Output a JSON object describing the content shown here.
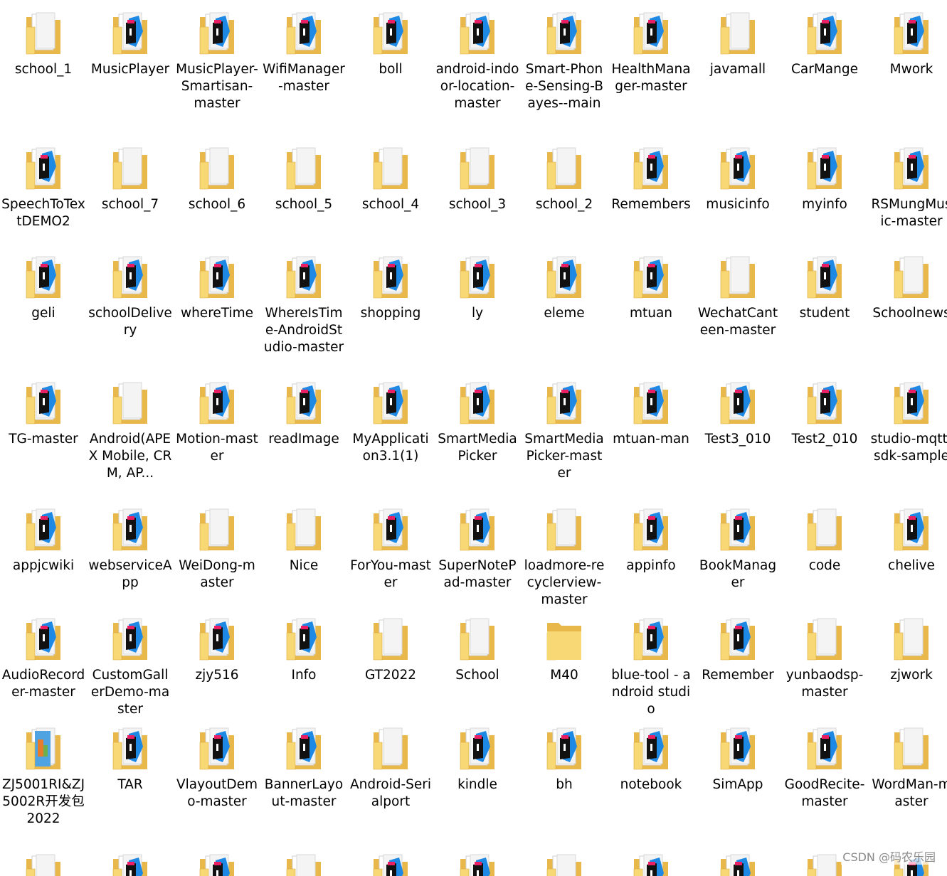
{
  "colors": {
    "folder_back": "#E8B84A",
    "folder_front": "#F8D775",
    "folder_edge": "#D9A838",
    "paper": "#FFFFFF",
    "android_blue": "#1E88E5",
    "ide_black": "#111111",
    "ide_pink": "#E91E63",
    "label_text": "#000000"
  },
  "folders": [
    {
      "label": "school_1",
      "icon": "folder-with-documents-icon"
    },
    {
      "label": "MusicPlayer",
      "icon": "folder-android-studio-icon"
    },
    {
      "label": "MusicPlayer-Smartisan-master",
      "icon": "folder-android-studio-icon"
    },
    {
      "label": "WifiManager-master",
      "icon": "folder-android-studio-icon"
    },
    {
      "label": "boll",
      "icon": "folder-android-studio-icon"
    },
    {
      "label": "android-indoor-location-master",
      "icon": "folder-android-studio-icon"
    },
    {
      "label": "Smart-Phone-Sensing-Bayes--main",
      "icon": "folder-android-studio-icon"
    },
    {
      "label": "HealthManager-master",
      "icon": "folder-android-studio-icon"
    },
    {
      "label": "javamall",
      "icon": "folder-with-documents-icon"
    },
    {
      "label": "CarMange",
      "icon": "folder-android-studio-icon"
    },
    {
      "label": "Mwork",
      "icon": "folder-android-studio-icon"
    },
    {
      "label": "SpeechToTextDEMO2",
      "icon": "folder-android-studio-icon"
    },
    {
      "label": "school_7",
      "icon": "folder-with-documents-icon"
    },
    {
      "label": "school_6",
      "icon": "folder-with-documents-icon"
    },
    {
      "label": "school_5",
      "icon": "folder-with-documents-icon"
    },
    {
      "label": "school_4",
      "icon": "folder-with-documents-icon"
    },
    {
      "label": "school_3",
      "icon": "folder-with-documents-icon"
    },
    {
      "label": "school_2",
      "icon": "folder-with-documents-icon"
    },
    {
      "label": "Remembers",
      "icon": "folder-android-studio-icon"
    },
    {
      "label": "musicinfo",
      "icon": "folder-android-studio-icon"
    },
    {
      "label": "myinfo",
      "icon": "folder-android-studio-icon"
    },
    {
      "label": "RSMungMusic-master",
      "icon": "folder-android-studio-icon"
    },
    {
      "label": "geli",
      "icon": "folder-android-studio-icon"
    },
    {
      "label": "schoolDelivery",
      "icon": "folder-android-studio-icon"
    },
    {
      "label": "whereTime",
      "icon": "folder-android-studio-icon"
    },
    {
      "label": "WhereIsTime-AndroidStudio-master",
      "icon": "folder-android-studio-icon"
    },
    {
      "label": "shopping",
      "icon": "folder-android-studio-icon"
    },
    {
      "label": "ly",
      "icon": "folder-android-studio-icon"
    },
    {
      "label": "eleme",
      "icon": "folder-android-studio-icon"
    },
    {
      "label": "mtuan",
      "icon": "folder-android-studio-icon"
    },
    {
      "label": "WechatCanteen-master",
      "icon": "folder-with-documents-icon"
    },
    {
      "label": "student",
      "icon": "folder-android-studio-icon"
    },
    {
      "label": "Schoolnews",
      "icon": "folder-with-documents-icon"
    },
    {
      "label": "TG-master",
      "icon": "folder-android-studio-icon"
    },
    {
      "label": "Android(APEX Mobile, CRM, AP...",
      "icon": "folder-with-documents-icon"
    },
    {
      "label": "Motion-master",
      "icon": "folder-android-studio-icon"
    },
    {
      "label": "readImage",
      "icon": "folder-android-studio-icon"
    },
    {
      "label": "MyApplication3.1(1)",
      "icon": "folder-android-studio-icon"
    },
    {
      "label": "SmartMediaPicker",
      "icon": "folder-android-studio-icon"
    },
    {
      "label": "SmartMediaPicker-master",
      "icon": "folder-android-studio-icon"
    },
    {
      "label": "mtuan-man",
      "icon": "folder-android-studio-icon"
    },
    {
      "label": "Test3_010",
      "icon": "folder-android-studio-icon"
    },
    {
      "label": "Test2_010",
      "icon": "folder-android-studio-icon"
    },
    {
      "label": "studio-mqtt-sdk-sample",
      "icon": "folder-android-studio-icon"
    },
    {
      "label": "appjcwiki",
      "icon": "folder-android-studio-icon"
    },
    {
      "label": "webserviceApp",
      "icon": "folder-android-studio-icon"
    },
    {
      "label": "WeiDong-master",
      "icon": "folder-with-documents-icon"
    },
    {
      "label": "Nice",
      "icon": "folder-with-documents-icon"
    },
    {
      "label": "ForYou-master",
      "icon": "folder-android-studio-icon"
    },
    {
      "label": "SuperNotePad-master",
      "icon": "folder-android-studio-icon"
    },
    {
      "label": "loadmore-recyclerview-master",
      "icon": "folder-with-documents-icon"
    },
    {
      "label": "appinfo",
      "icon": "folder-android-studio-icon"
    },
    {
      "label": "BookManager",
      "icon": "folder-android-studio-icon"
    },
    {
      "label": "code",
      "icon": "folder-with-documents-icon"
    },
    {
      "label": "chelive",
      "icon": "folder-android-studio-icon"
    },
    {
      "label": "AudioRecorder-master",
      "icon": "folder-android-studio-icon"
    },
    {
      "label": "CustomGallerDemo-master",
      "icon": "folder-android-studio-icon"
    },
    {
      "label": "zjy516",
      "icon": "folder-android-studio-icon"
    },
    {
      "label": "Info",
      "icon": "folder-android-studio-icon"
    },
    {
      "label": "GT2022",
      "icon": "folder-with-documents-icon"
    },
    {
      "label": "School",
      "icon": "folder-with-documents-icon"
    },
    {
      "label": "M40",
      "icon": "folder-icon"
    },
    {
      "label": "blue-tool - android studio",
      "icon": "folder-android-studio-icon"
    },
    {
      "label": "Remember",
      "icon": "folder-android-studio-icon"
    },
    {
      "label": "yunbaodsp-master",
      "icon": "folder-with-documents-icon"
    },
    {
      "label": "zjwork",
      "icon": "folder-with-documents-icon"
    },
    {
      "label": "ZJ5001RI&ZJ5002R开发包2022",
      "icon": "folder-archive-icon"
    },
    {
      "label": "TAR",
      "icon": "folder-android-studio-icon"
    },
    {
      "label": "VlayoutDemo-master",
      "icon": "folder-android-studio-icon"
    },
    {
      "label": "BannerLayout-master",
      "icon": "folder-android-studio-icon"
    },
    {
      "label": "Android-Serialport",
      "icon": "folder-with-documents-icon"
    },
    {
      "label": "kindle",
      "icon": "folder-android-studio-icon"
    },
    {
      "label": "bh",
      "icon": "folder-android-studio-icon"
    },
    {
      "label": "notebook",
      "icon": "folder-android-studio-icon"
    },
    {
      "label": "SimApp",
      "icon": "folder-android-studio-icon"
    },
    {
      "label": "GoodRecite-master",
      "icon": "folder-android-studio-icon"
    },
    {
      "label": "WordMan-master",
      "icon": "folder-with-documents-icon"
    }
  ],
  "partial_row_count": 11,
  "watermark": "CSDN @码农乐园"
}
